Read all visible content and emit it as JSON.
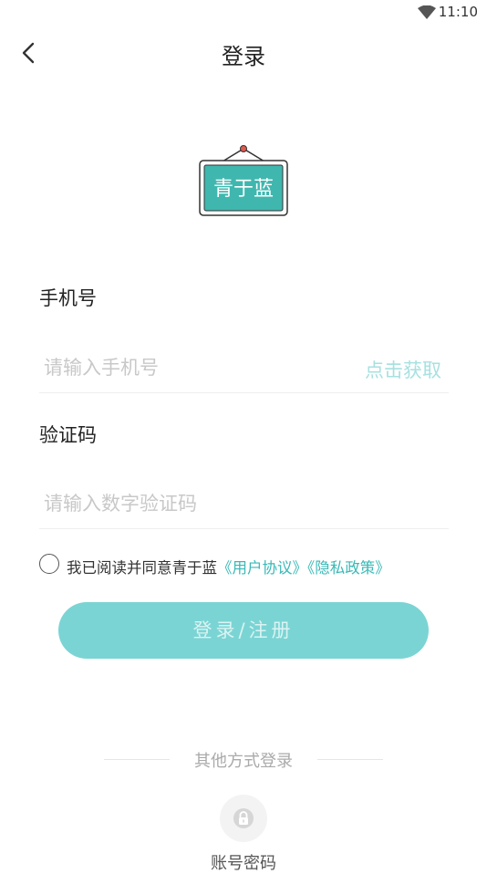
{
  "status_bar": {
    "time": "11:10",
    "wifi_icon": "wifi-icon"
  },
  "nav": {
    "title": "登录",
    "back_icon": "chevron-left-icon"
  },
  "logo": {
    "text": "青于蓝",
    "frame_color": "#2a9c95",
    "board_color": "#3fb7af"
  },
  "form": {
    "phone_label": "手机号",
    "phone_placeholder": "请输入手机号",
    "get_code_label": "点击获取",
    "code_label": "验证码",
    "code_placeholder": "请输入数字验证码"
  },
  "agreement": {
    "prefix": "我已阅读并同意青于蓝",
    "user_agreement": "《用户协议》",
    "privacy_policy": "《隐私政策》",
    "checked": false
  },
  "login_button": {
    "label": "登录/注册"
  },
  "other_login": {
    "title": "其他方式登录",
    "method_label": "账号密码",
    "method_icon": "lock-icon"
  },
  "colors": {
    "accent": "#7bd4d4",
    "link": "#38b9b6",
    "get_code": "#a6e1e0"
  }
}
